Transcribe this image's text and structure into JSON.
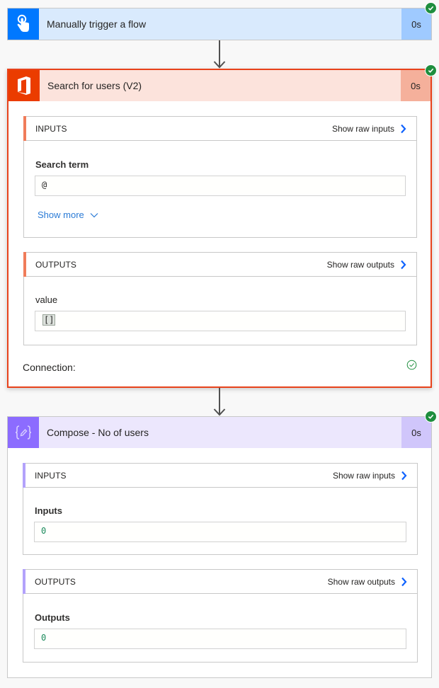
{
  "colors": {
    "trigger_icon_bg": "#0078ff",
    "trigger_header_bg": "#d9eafd",
    "trigger_duration_bg": "#9fcaff",
    "office_icon_bg": "#eb3c00",
    "office_header_bg": "#fce3dc",
    "office_duration_bg": "#f5b09b",
    "office_border": "#e8421b",
    "office_accent": "#f07c5a",
    "compose_icon_bg": "#8c6cff",
    "compose_header_bg": "#ece7fd",
    "compose_duration_bg": "#d0c6fb",
    "compose_accent": "#b3a2fb",
    "success_green": "#1e8e3e",
    "link_blue": "#0f62fe"
  },
  "trigger": {
    "icon": "touch-hand-icon",
    "title": "Manually trigger a flow",
    "duration": "0s",
    "status": "succeeded"
  },
  "search_users": {
    "icon": "office-365-icon",
    "title": "Search for users (V2)",
    "duration": "0s",
    "status": "succeeded",
    "inputs": {
      "header": "INPUTS",
      "raw_link": "Show raw inputs",
      "field_label": "Search term",
      "field_value": "@",
      "show_more": "Show more"
    },
    "outputs": {
      "header": "OUTPUTS",
      "raw_link": "Show raw outputs",
      "field_label": "value",
      "field_value": "[]"
    },
    "connection_label": "Connection:",
    "connection_status": "connected"
  },
  "compose": {
    "icon": "compose-braces-icon",
    "title": "Compose - No of users",
    "duration": "0s",
    "status": "succeeded",
    "inputs": {
      "header": "INPUTS",
      "raw_link": "Show raw inputs",
      "field_label": "Inputs",
      "field_value": "0"
    },
    "outputs": {
      "header": "OUTPUTS",
      "raw_link": "Show raw outputs",
      "field_label": "Outputs",
      "field_value": "0"
    }
  }
}
